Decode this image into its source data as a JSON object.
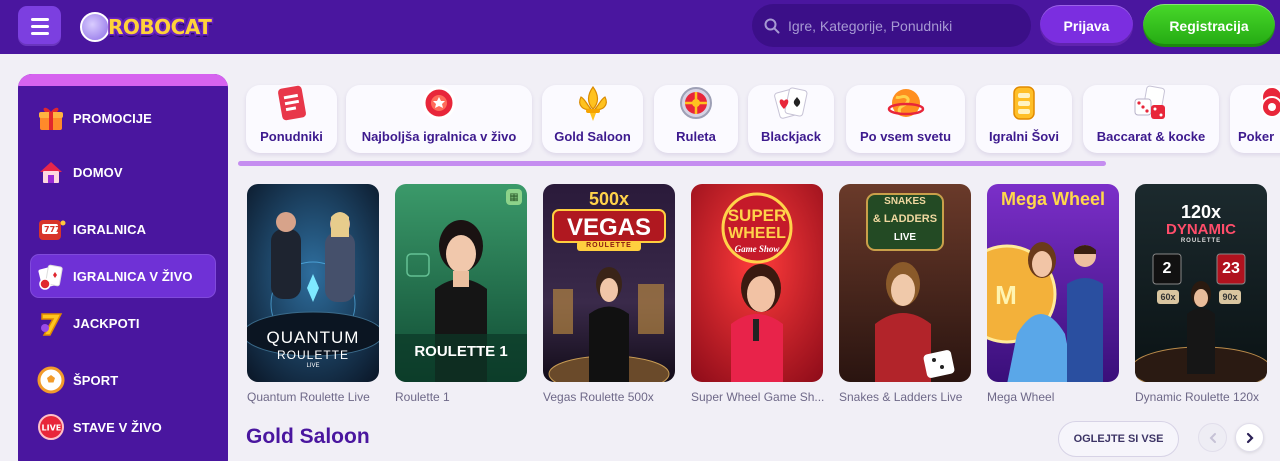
{
  "header": {
    "menu_icon": "hamburger-icon",
    "logo_text": "ROBOCAT",
    "search_placeholder": "Igre, Kategorije, Ponudniki",
    "search_icon": "search-icon",
    "login_label": "Prijava",
    "register_label": "Registracija"
  },
  "sidebar": {
    "items": [
      {
        "label": "PROMOCIJE",
        "icon": "gift-icon"
      },
      {
        "label": "DOMOV",
        "icon": "home-icon"
      },
      {
        "label": "IGRALNICA",
        "icon": "slot-machine-icon"
      },
      {
        "label": "IGRALNICA V ŽIVO",
        "icon": "playing-cards-icon",
        "active": true
      },
      {
        "label": "JACKPOTI",
        "icon": "lucky-seven-icon"
      },
      {
        "label": "ŠPORT",
        "icon": "soccer-ball-icon"
      },
      {
        "label": "STAVE V ŽIVO",
        "icon": "live-badge-icon"
      }
    ]
  },
  "categories": [
    {
      "label": "Ponudniki",
      "icon": "provider-cards-icon"
    },
    {
      "label": "Najboljša igralnica v živo",
      "icon": "poker-chip-icon"
    },
    {
      "label": "Gold Saloon",
      "icon": "gold-fleur-icon"
    },
    {
      "label": "Ruleta",
      "icon": "roulette-wheel-icon"
    },
    {
      "label": "Blackjack",
      "icon": "blackjack-cards-icon"
    },
    {
      "label": "Po vsem svetu",
      "icon": "globe-icon"
    },
    {
      "label": "Igralni Šovi",
      "icon": "game-show-icon"
    },
    {
      "label": "Baccarat & kocke",
      "icon": "dice-cards-icon"
    },
    {
      "label": "Poker",
      "icon": "poker-chips-icon"
    }
  ],
  "games": [
    {
      "title": "Quantum Roulette Live",
      "art_line1": "QUANTUM",
      "art_line2": "ROULETTE",
      "art_line3": "LIVE"
    },
    {
      "title": "Roulette 1",
      "art_line1": "ROULETTE 1"
    },
    {
      "title": "Vegas Roulette 500x",
      "art_line1": "500x",
      "art_line2": "VEGAS",
      "art_line3": "ROULETTE"
    },
    {
      "title": "Super Wheel Game Sh...",
      "art_line1": "SUPER",
      "art_line2": "WHEEL",
      "art_line3": "Game Show"
    },
    {
      "title": "Snakes & Ladders Live",
      "art_line1": "SNAKES",
      "art_line2": "& LADDERS",
      "art_line3": "LIVE"
    },
    {
      "title": "Mega Wheel",
      "art_line1": "Mega Wheel",
      "art_line2": "M"
    },
    {
      "title": "Dynamic Roulette 120x",
      "art_line1": "120x",
      "art_line2": "DYNAMIC",
      "art_line3": "ROULETTE",
      "num_left": "2",
      "num_right": "23",
      "mult_left": "60x",
      "mult_right": "90x"
    }
  ],
  "section": {
    "title": "Gold Saloon",
    "see_all_label": "OGLEJTE SI VSE",
    "prev_icon": "chevron-left-icon",
    "next_icon": "chevron-right-icon"
  },
  "colors": {
    "header_bg": "#4a169f",
    "sidebar_bg": "#4a169f",
    "accent_purple": "#7b2ee0",
    "register_green": "#2fbf1a",
    "page_bg": "#f1eff6"
  }
}
